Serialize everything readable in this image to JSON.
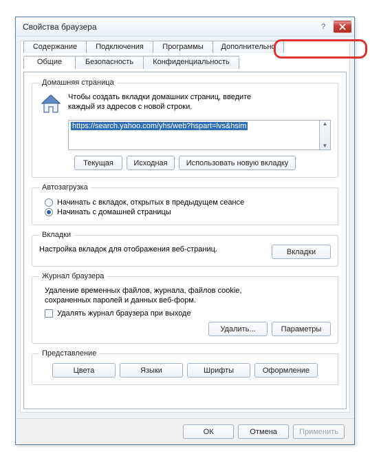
{
  "window": {
    "title": "Свойства браузера"
  },
  "tabs_row1": [
    {
      "label": "Содержание"
    },
    {
      "label": "Подключения"
    },
    {
      "label": "Программы"
    },
    {
      "label": "Дополнительно"
    }
  ],
  "tabs_row2": [
    {
      "label": "Общие",
      "active": true
    },
    {
      "label": "Безопасность"
    },
    {
      "label": "Конфиденциальность"
    }
  ],
  "homepage": {
    "legend": "Домашняя страница",
    "desc1": "Чтобы создать вкладки домашних страниц, введите",
    "desc2": "каждый из адресов с новой строки.",
    "url": "https://search.yahoo.com/yhs/web?hspart=lvs&hsim",
    "btn_current": "Текущая",
    "btn_default": "Исходная",
    "btn_newtab": "Использовать новую вкладку"
  },
  "startup": {
    "legend": "Автозагрузка",
    "opt_tabs": "Начинать с вкладок, открытых в предыдущем сеансе",
    "opt_home": "Начинать с домашней страницы"
  },
  "tabsGroup": {
    "legend": "Вкладки",
    "desc": "Настройка вкладок для отображения веб-страниц.",
    "btn": "Вкладки"
  },
  "history": {
    "legend": "Журнал браузера",
    "desc1": "Удаление временных файлов, журнала, файлов cookie,",
    "desc2": "сохраненных паролей и данных веб-форм.",
    "check": "Удалять журнал браузера при выходе",
    "btn_delete": "Удалить...",
    "btn_params": "Параметры"
  },
  "appearance": {
    "legend": "Представление",
    "btn_colors": "Цвета",
    "btn_langs": "Языки",
    "btn_fonts": "Шрифты",
    "btn_style": "Оформление"
  },
  "footer": {
    "ok": "ОК",
    "cancel": "Отмена",
    "apply": "Применить"
  }
}
